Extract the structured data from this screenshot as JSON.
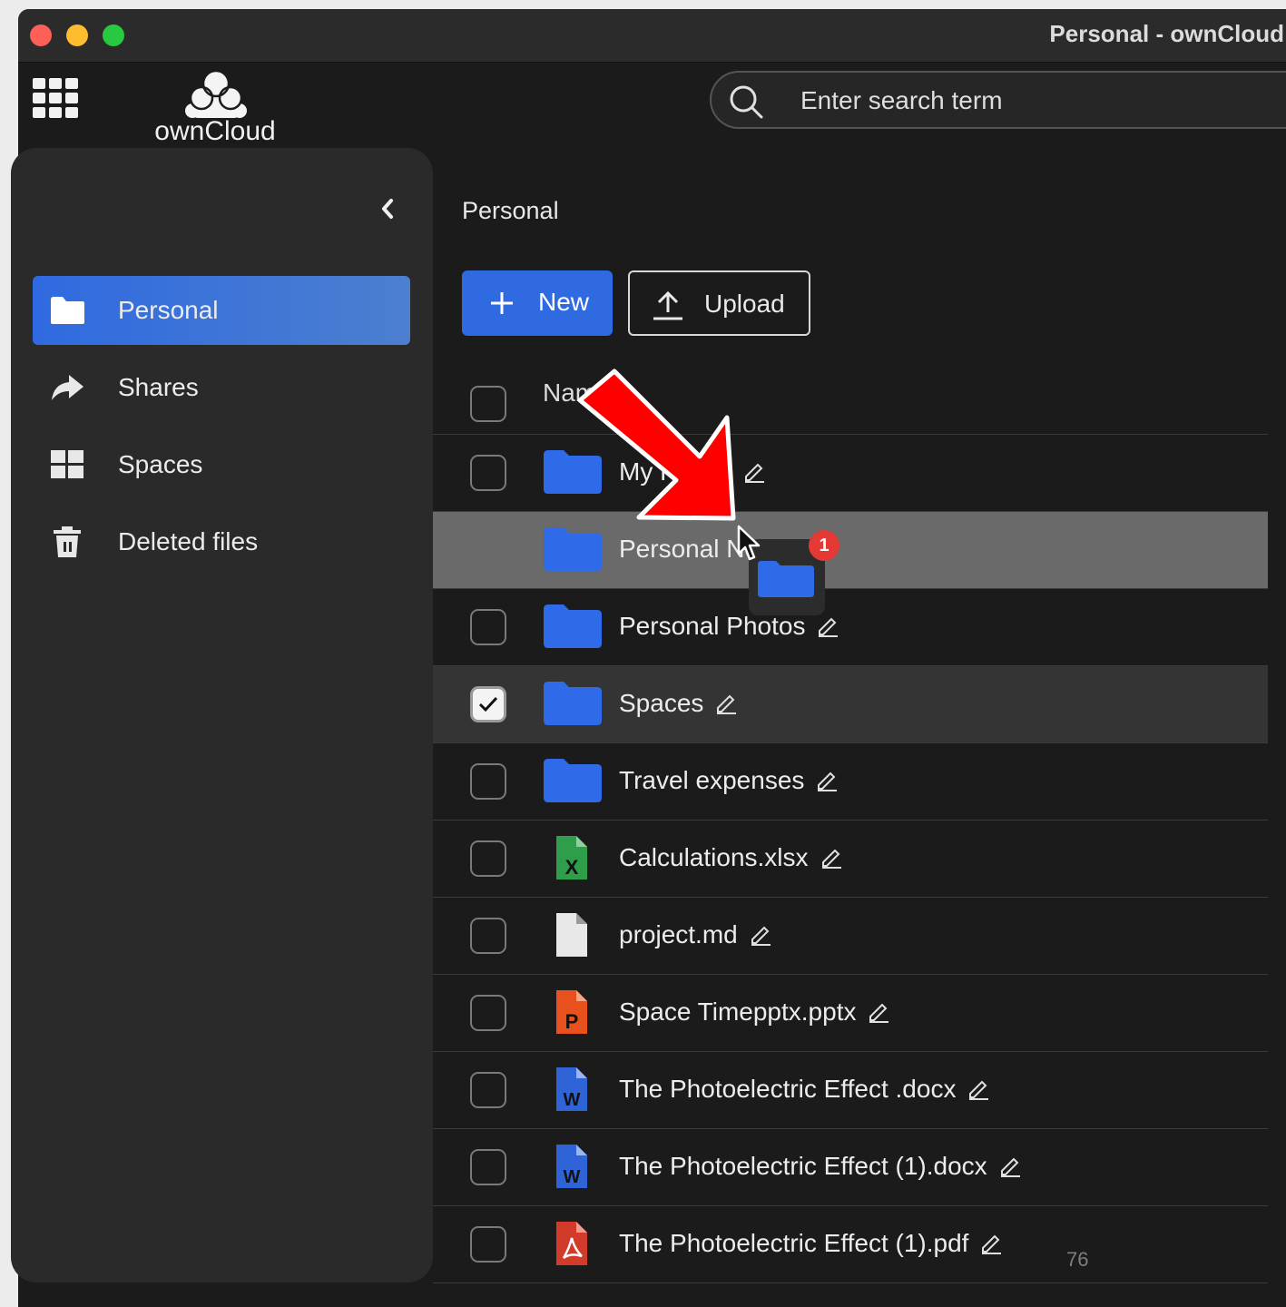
{
  "window": {
    "title": "Personal - ownCloud"
  },
  "header": {
    "logo_text": "ownCloud",
    "search": {
      "placeholder": "Enter search term",
      "value": ""
    }
  },
  "sidebar": {
    "items": [
      {
        "label": "Personal",
        "icon": "folder-icon",
        "active": true
      },
      {
        "label": "Shares",
        "icon": "share-icon",
        "active": false
      },
      {
        "label": "Spaces",
        "icon": "spaces-icon",
        "active": false
      },
      {
        "label": "Deleted files",
        "icon": "trash-icon",
        "active": false
      }
    ]
  },
  "main": {
    "breadcrumb": "Personal",
    "new_label": "New",
    "upload_label": "Upload",
    "column_name": "Name",
    "files": [
      {
        "name": "My Folder",
        "type": "folder",
        "selected": false
      },
      {
        "name": "Personal Notes",
        "type": "folder",
        "selected": false,
        "drop_target": true
      },
      {
        "name": "Personal Photos",
        "type": "folder",
        "selected": false
      },
      {
        "name": "Spaces",
        "type": "folder",
        "selected": true
      },
      {
        "name": "Travel expenses",
        "type": "folder",
        "selected": false
      },
      {
        "name": "Calculations.xlsx",
        "type": "xlsx",
        "selected": false
      },
      {
        "name": "project.md",
        "type": "md",
        "selected": false
      },
      {
        "name": "Space Timepptx.pptx",
        "type": "pptx",
        "selected": false
      },
      {
        "name": "The Photoelectric Effect .docx",
        "type": "docx",
        "selected": false
      },
      {
        "name": "The Photoelectric Effect (1).docx",
        "type": "docx",
        "selected": false
      },
      {
        "name": "The Photoelectric Effect (1).pdf",
        "type": "pdf",
        "selected": false
      }
    ],
    "page_number": "76"
  },
  "drag": {
    "count": "1"
  },
  "colors": {
    "accent": "#2f6ae0",
    "folder": "#2f6ae8",
    "badge": "#e53935",
    "annotation_arrow": "#ff0000"
  }
}
